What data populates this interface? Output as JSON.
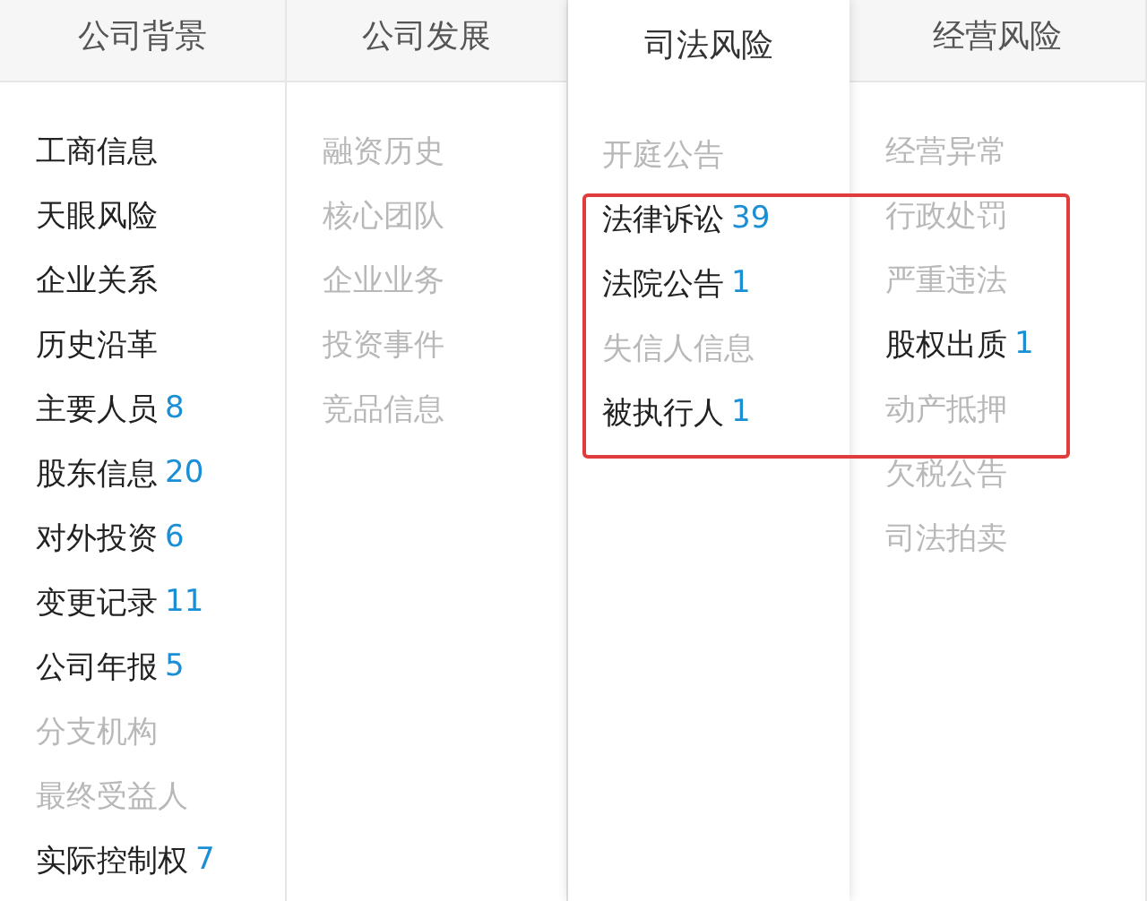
{
  "columns": [
    {
      "tab": {
        "label": "公司背景",
        "selected": false
      },
      "items": [
        {
          "label": "工商信息",
          "disabled": false
        },
        {
          "label": "天眼风险",
          "disabled": false
        },
        {
          "label": "企业关系",
          "disabled": false
        },
        {
          "label": "历史沿革",
          "disabled": false
        },
        {
          "label": "主要人员",
          "count": "8",
          "disabled": false
        },
        {
          "label": "股东信息",
          "count": "20",
          "disabled": false
        },
        {
          "label": "对外投资",
          "count": "6",
          "disabled": false
        },
        {
          "label": "变更记录",
          "count": "11",
          "disabled": false
        },
        {
          "label": "公司年报",
          "count": "5",
          "disabled": false
        },
        {
          "label": "分支机构",
          "disabled": true
        },
        {
          "label": "最终受益人",
          "disabled": true
        },
        {
          "label": "实际控制权",
          "count": "7",
          "disabled": false
        }
      ]
    },
    {
      "tab": {
        "label": "公司发展",
        "selected": false
      },
      "items": [
        {
          "label": "融资历史",
          "disabled": true
        },
        {
          "label": "核心团队",
          "disabled": true
        },
        {
          "label": "企业业务",
          "disabled": true
        },
        {
          "label": "投资事件",
          "disabled": true
        },
        {
          "label": "竞品信息",
          "disabled": true
        }
      ]
    },
    {
      "tab": {
        "label": "司法风险",
        "selected": true
      },
      "items": [
        {
          "label": "开庭公告",
          "disabled": true
        },
        {
          "label": "法律诉讼",
          "count": "39",
          "disabled": false
        },
        {
          "label": "法院公告",
          "count": "1",
          "disabled": false
        },
        {
          "label": "失信人信息",
          "disabled": true
        },
        {
          "label": "被执行人",
          "count": "1",
          "disabled": false
        }
      ]
    },
    {
      "tab": {
        "label": "经营风险",
        "selected": false
      },
      "items": [
        {
          "label": "经营异常",
          "disabled": true
        },
        {
          "label": "行政处罚",
          "disabled": true
        },
        {
          "label": "严重违法",
          "disabled": true
        },
        {
          "label": "股权出质",
          "count": "1",
          "disabled": false
        },
        {
          "label": "动产抵押",
          "disabled": true
        },
        {
          "label": "欠税公告",
          "disabled": true
        },
        {
          "label": "司法拍卖",
          "disabled": true
        }
      ]
    }
  ]
}
